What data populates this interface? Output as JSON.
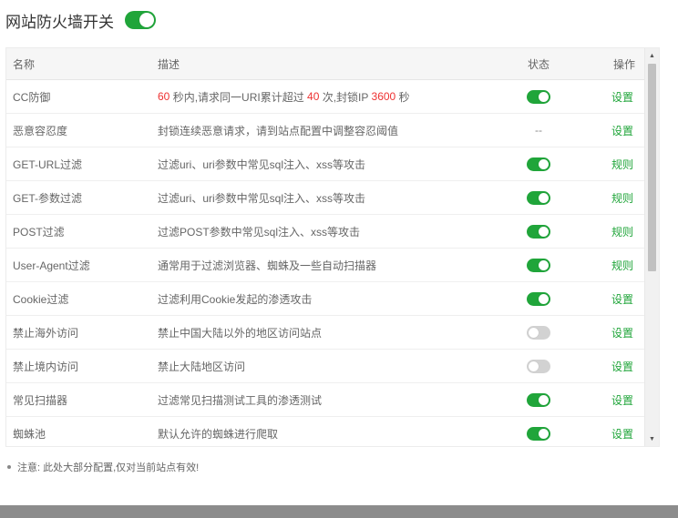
{
  "header": {
    "title": "网站防火墙开关",
    "switch_on": true
  },
  "table": {
    "columns": {
      "name": "名称",
      "desc": "描述",
      "status": "状态",
      "op": "操作"
    },
    "cc_row": {
      "name": "CC防御",
      "desc_seconds": "60",
      "desc_part1": " 秒内,请求同一URI累计超过 ",
      "desc_count": "40",
      "desc_part2": " 次,封锁IP ",
      "desc_block": "3600",
      "desc_part3": " 秒",
      "status": "on",
      "op": "设置"
    },
    "rows": [
      {
        "name": "恶意容忍度",
        "desc": "封锁连续恶意请求，请到站点配置中调整容忍阈值",
        "status": "--",
        "op": "设置"
      },
      {
        "name": "GET-URL过滤",
        "desc": "过滤uri、uri参数中常见sql注入、xss等攻击",
        "status": "on",
        "op": "规则"
      },
      {
        "name": "GET-参数过滤",
        "desc": "过滤uri、uri参数中常见sql注入、xss等攻击",
        "status": "on",
        "op": "规则"
      },
      {
        "name": "POST过滤",
        "desc": "过滤POST参数中常见sql注入、xss等攻击",
        "status": "on",
        "op": "规则"
      },
      {
        "name": "User-Agent过滤",
        "desc": "通常用于过滤浏览器、蜘蛛及一些自动扫描器",
        "status": "on",
        "op": "规则"
      },
      {
        "name": "Cookie过滤",
        "desc": "过滤利用Cookie发起的渗透攻击",
        "status": "on",
        "op": "设置"
      },
      {
        "name": "禁止海外访问",
        "desc": "禁止中国大陆以外的地区访问站点",
        "status": "off",
        "op": "设置"
      },
      {
        "name": "禁止境内访问",
        "desc": "禁止大陆地区访问",
        "status": "off",
        "op": "设置"
      },
      {
        "name": "常见扫描器",
        "desc": "过滤常见扫描测试工具的渗透测试",
        "status": "on",
        "op": "设置"
      },
      {
        "name": "蜘蛛池",
        "desc": "默认允许的蜘蛛进行爬取",
        "status": "on",
        "op": "设置"
      }
    ]
  },
  "note": "注意: 此处大部分配置,仅对当前站点有效!",
  "colors": {
    "accent": "#20a53a",
    "highlight": "#ee3232"
  }
}
